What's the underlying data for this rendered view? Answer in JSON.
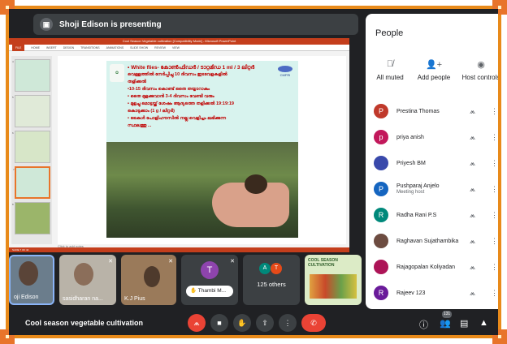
{
  "presenter_banner": "Shoji Edison is presenting",
  "ppt": {
    "window_title": "Cool Season Vegetable cultivation [Compatibility Mode] - Microsoft PowerPoint",
    "tabs": [
      "FILE",
      "HOME",
      "INSERT",
      "DESIGN",
      "TRANSITIONS",
      "ANIMATIONS",
      "SLIDE SHOW",
      "REVIEW",
      "VIEW"
    ],
    "thumb_numbers": [
      "4",
      "5",
      "6",
      "7",
      "8"
    ],
    "notes_placeholder": "Click to add notes",
    "status": "SLIDE 7 OF 44"
  },
  "slide": {
    "logo_right": "CMFRI",
    "lines": [
      "• White flies- കോൺഫിഡർ / ടാറ്റമിഡ 1 ml / 3 ലിറ്റർ",
      "വെള്ളത്തിൽ നേർപ്പിച്ചു 10 ദിവസം ഇടവേളകളിൽ",
      "തളിക്കൽ",
      "•10-15 ദിവസം കൊണ്ട് തൈ തയ്യാറാകും",
      "• തൈ മുളക്കുവാൻ 3-4 ദിവസം വേണ്ടി വരും",
      "• മുളച്ചു മൊട്ടയ്ക്ക് ശേഷം ആദ്യത്തെ തളിക്കൽ 19:19:19",
      "കൊടുക്കാം (1 g / ലിറ്റർ)",
      "• ട്രേകൾ പോളിഹൗസിൽ നല്ല വെളിച്ചം ലഭിക്കുന്ന",
      "സ്ഥലത്തു ..."
    ]
  },
  "people_panel": {
    "title": "People",
    "controls": [
      {
        "label": "All muted",
        "icon": "mic-off-icon"
      },
      {
        "label": "Add people",
        "icon": "add-person-icon"
      },
      {
        "label": "Host controls",
        "icon": "toggle-icon"
      }
    ],
    "participants": [
      {
        "name": "Prestina Thomas",
        "initial": "P",
        "color": "#c0392b",
        "sub": ""
      },
      {
        "name": "priya anish",
        "initial": "p",
        "color": "#c2185b",
        "sub": ""
      },
      {
        "name": "Priyesh BM",
        "initial": "",
        "color": "#3949ab",
        "sub": ""
      },
      {
        "name": "Pushparaj Anjelo",
        "initial": "P",
        "color": "#1565c0",
        "sub": "Meeting host"
      },
      {
        "name": "Radha Rani P.S",
        "initial": "R",
        "color": "#00897b",
        "sub": ""
      },
      {
        "name": "Raghavan Sujathambika",
        "initial": "",
        "color": "#6d4c41",
        "sub": ""
      },
      {
        "name": "Rajagopalan Koliyadan",
        "initial": "",
        "color": "#ad1457",
        "sub": ""
      },
      {
        "name": "Rajeev 123",
        "initial": "R",
        "color": "#6a1b9a",
        "sub": ""
      }
    ]
  },
  "filmstrip": [
    {
      "name": "oji Edison"
    },
    {
      "name": "sasidharan na..."
    },
    {
      "name": "K.J Pius"
    },
    {
      "name": "Thambi M...",
      "initial": "T"
    },
    {
      "name": "125 others",
      "initials": [
        "A",
        "T"
      ]
    },
    {
      "name": "COOL SEASON CULTIVATION"
    }
  ],
  "bottom": {
    "meeting_title": "Cool season vegetable cultivation",
    "participant_count": "131"
  },
  "colors": {
    "frame": "#e88a1a",
    "accent_red": "#ea4335",
    "ppt_red": "#c43e1c"
  }
}
